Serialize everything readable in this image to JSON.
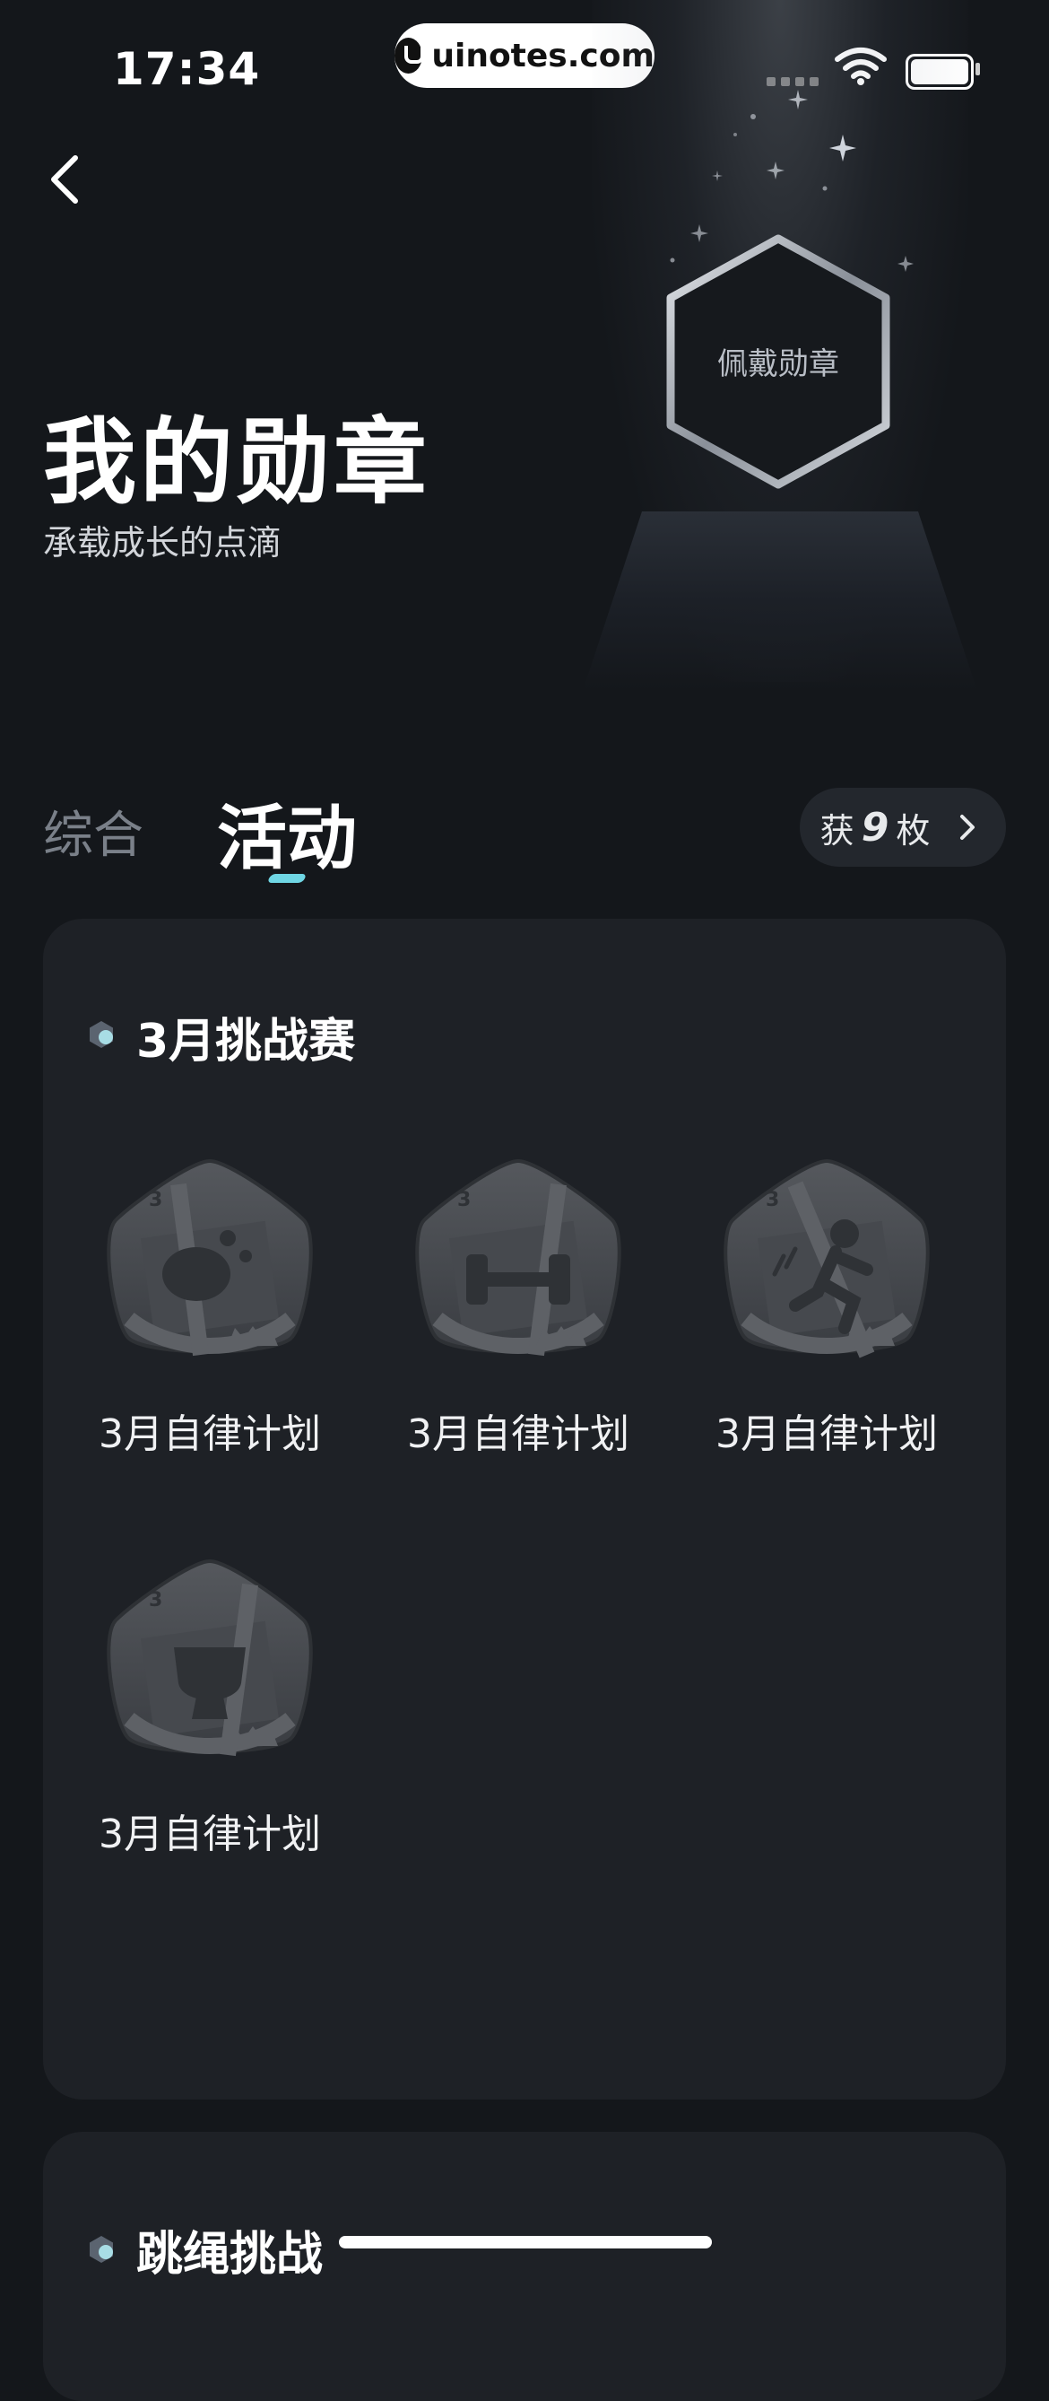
{
  "status_bar": {
    "time": "17:34",
    "watermark": "uinotes.com"
  },
  "header": {
    "title": "我的勋章",
    "subtitle": "承载成长的点滴",
    "wear_badge_label": "佩戴勋章"
  },
  "tabs": [
    {
      "label": "综合",
      "active": false
    },
    {
      "label": "活动",
      "active": true
    }
  ],
  "count": {
    "prefix": "获",
    "value": "9",
    "suffix": "枚"
  },
  "sections": [
    {
      "title": "3月挑战赛",
      "badges": [
        {
          "label": "3月自律计划",
          "icon": "bean-badge-icon"
        },
        {
          "label": "3月自律计划",
          "icon": "dumbbell-badge-icon"
        },
        {
          "label": "3月自律计划",
          "icon": "runner-badge-icon"
        },
        {
          "label": "3月自律计划",
          "icon": "trophy-badge-icon"
        }
      ]
    },
    {
      "title": "跳绳挑战",
      "badges": []
    }
  ],
  "colors": {
    "background": "#14171b",
    "card": "#1e2126",
    "accent": "#6fd6e4"
  }
}
